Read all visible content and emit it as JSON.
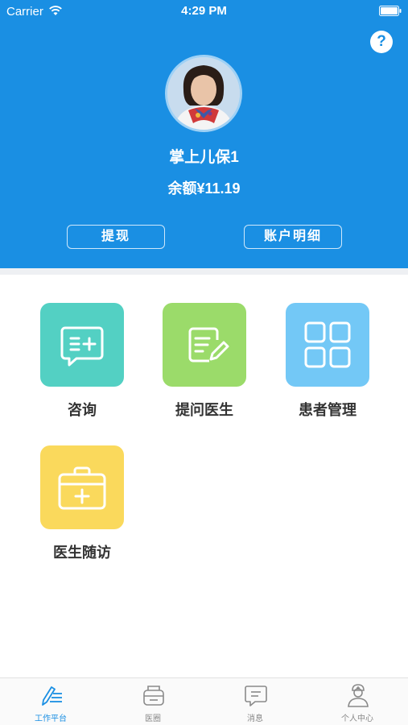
{
  "status_bar": {
    "carrier": "Carrier",
    "time": "4:29 PM"
  },
  "header": {
    "help_label": "?",
    "username": "掌上儿保1",
    "balance": "余额¥11.19",
    "withdraw_label": "提现",
    "account_detail_label": "账户明细",
    "background_color": "#1a8fe3"
  },
  "grid": {
    "items": [
      {
        "label": "咨询",
        "icon": "consult-chat-icon",
        "color": "#53d0c3"
      },
      {
        "label": "提问医生",
        "icon": "edit-document-icon",
        "color": "#9bdb6a"
      },
      {
        "label": "患者管理",
        "icon": "grid-squares-icon",
        "color": "#73c8f6"
      },
      {
        "label": "医生随访",
        "icon": "medical-kit-icon",
        "color": "#fad95c"
      }
    ]
  },
  "tabbar": {
    "items": [
      {
        "label": "工作平台",
        "icon": "pen-list-icon",
        "active": true
      },
      {
        "label": "医圈",
        "icon": "printer-box-icon",
        "active": false
      },
      {
        "label": "消息",
        "icon": "message-bubble-icon",
        "active": false
      },
      {
        "label": "个人中心",
        "icon": "doctor-avatar-icon",
        "active": false
      }
    ],
    "active_color": "#1a8fe3"
  }
}
